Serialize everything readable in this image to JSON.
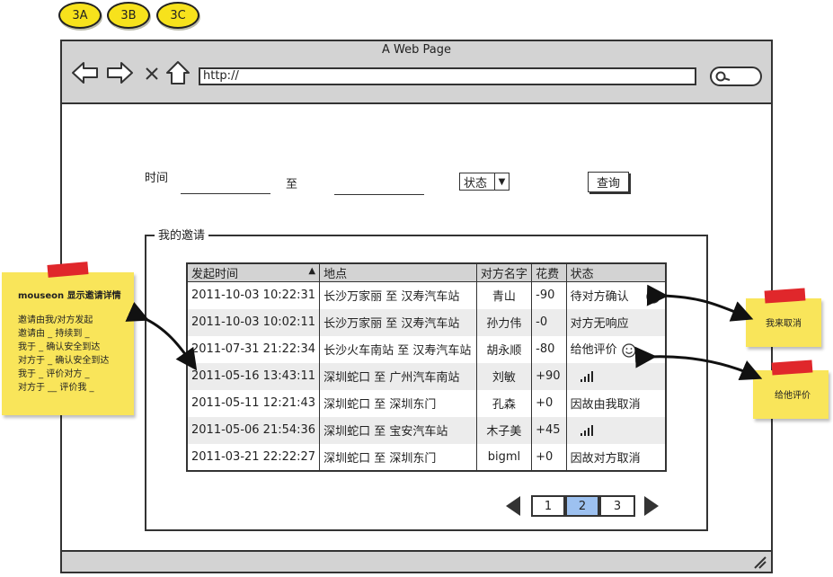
{
  "versions": [
    "3A",
    "3B",
    "3C"
  ],
  "browser": {
    "title": "A Web Page",
    "url": "http://",
    "icons": [
      "back-arrow-icon",
      "forward-arrow-icon",
      "stop-icon",
      "home-icon",
      "search-icon"
    ]
  },
  "filter": {
    "time_label": "时间",
    "to_label": "至",
    "status_select": "状态",
    "query_button": "查询"
  },
  "group": {
    "legend": "我的邀请"
  },
  "table": {
    "headers": [
      "发起时间",
      "地点",
      "对方名字",
      "花费",
      "状态"
    ],
    "rows": [
      {
        "time": "2011-10-03 10:22:31",
        "place": "长沙万家丽 至 汉寿汽车站",
        "name": "青山",
        "cost": "-90",
        "status": "待对方确认",
        "icon": "cancel-icon"
      },
      {
        "time": "2011-10-03 10:02:11",
        "place": "长沙万家丽 至 汉寿汽车站",
        "name": "孙力伟",
        "cost": "-0",
        "status": "对方无响应",
        "icon": ""
      },
      {
        "time": "2011-07-31 21:22:34",
        "place": "长沙火车南站 至 汉寿汽车站",
        "name": "胡永顺",
        "cost": "-80",
        "status": "给他评价",
        "icon": "smiley-icon"
      },
      {
        "time": "2011-05-16 13:43:11",
        "place": "深圳蛇口 至 广州汽车南站",
        "name": "刘敏",
        "cost": "+90",
        "status": "",
        "icon": "rating-bars-icon"
      },
      {
        "time": "2011-05-11 12:21:43",
        "place": "深圳蛇口 至 深圳东门",
        "name": "孔森",
        "cost": "+0",
        "status": "因故由我取消",
        "icon": ""
      },
      {
        "time": "2011-05-06 21:54:36",
        "place": "深圳蛇口 至 宝安汽车站",
        "name": "木子美",
        "cost": "+45",
        "status": "",
        "icon": "rating-bars-icon"
      },
      {
        "time": "2011-03-21 22:22:27",
        "place": "深圳蛇口 至 深圳东门",
        "name": "bigml",
        "cost": "+0",
        "status": "因故对方取消",
        "icon": ""
      }
    ]
  },
  "pagination": {
    "pages": [
      "1",
      "2",
      "3"
    ],
    "current": "2"
  },
  "notes": {
    "left_title": "mouseon 显示邀请详情",
    "left_lines": [
      "邀请由我/对方发起",
      "邀请由 _ 持续到 _",
      "我于 _ 确认安全到达",
      "对方于 _ 确认安全到达",
      "我于 _ 评价对方 _",
      "对方于 __ 评价我 _"
    ],
    "right1": "我来取消",
    "right2": "给他评价"
  },
  "colors": {
    "chrome": "#d3d3d3",
    "sticky": "#f9e55a",
    "tape": "#e0272b",
    "badge": "#f7e21c",
    "active_page": "#9dc1f0"
  }
}
